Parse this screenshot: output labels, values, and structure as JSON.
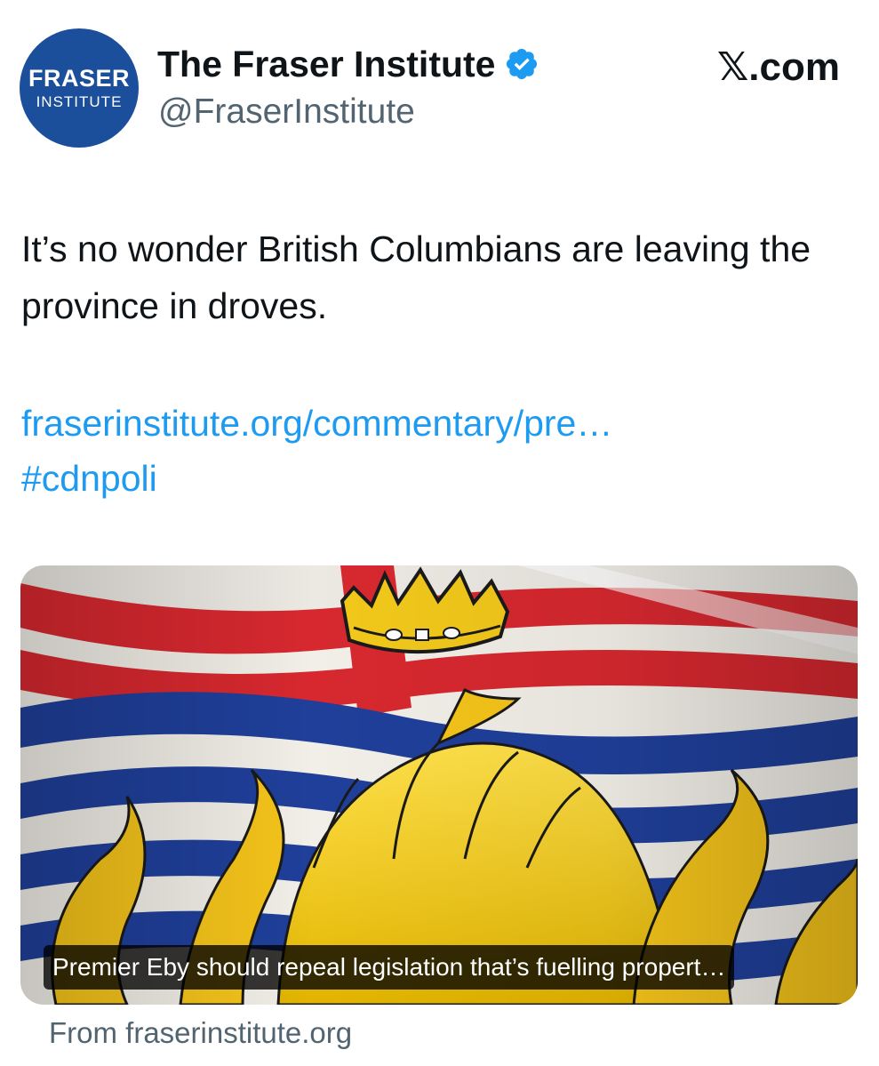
{
  "header": {
    "avatar": {
      "line1": "FRASER",
      "line2": "INSTITUTE"
    },
    "display_name": "The Fraser Institute",
    "handle": "@FraserInstitute",
    "site": "𝕏.com",
    "verified_icon": "verified-badge-icon"
  },
  "tweet": {
    "text": "It’s no wonder British Columbians are leaving the province in droves.",
    "link": "fraserinstitute.org/commentary/pre…",
    "hashtag": "#cdnpoli"
  },
  "card": {
    "image": "british-columbia-flag",
    "caption": "Premier Eby should repeal legislation that’s fuelling propert…",
    "source": "From fraserinstitute.org"
  },
  "colors": {
    "link": "#1d9bf0",
    "avatar_bg": "#1b4f9c",
    "secondary_text": "#536471"
  }
}
